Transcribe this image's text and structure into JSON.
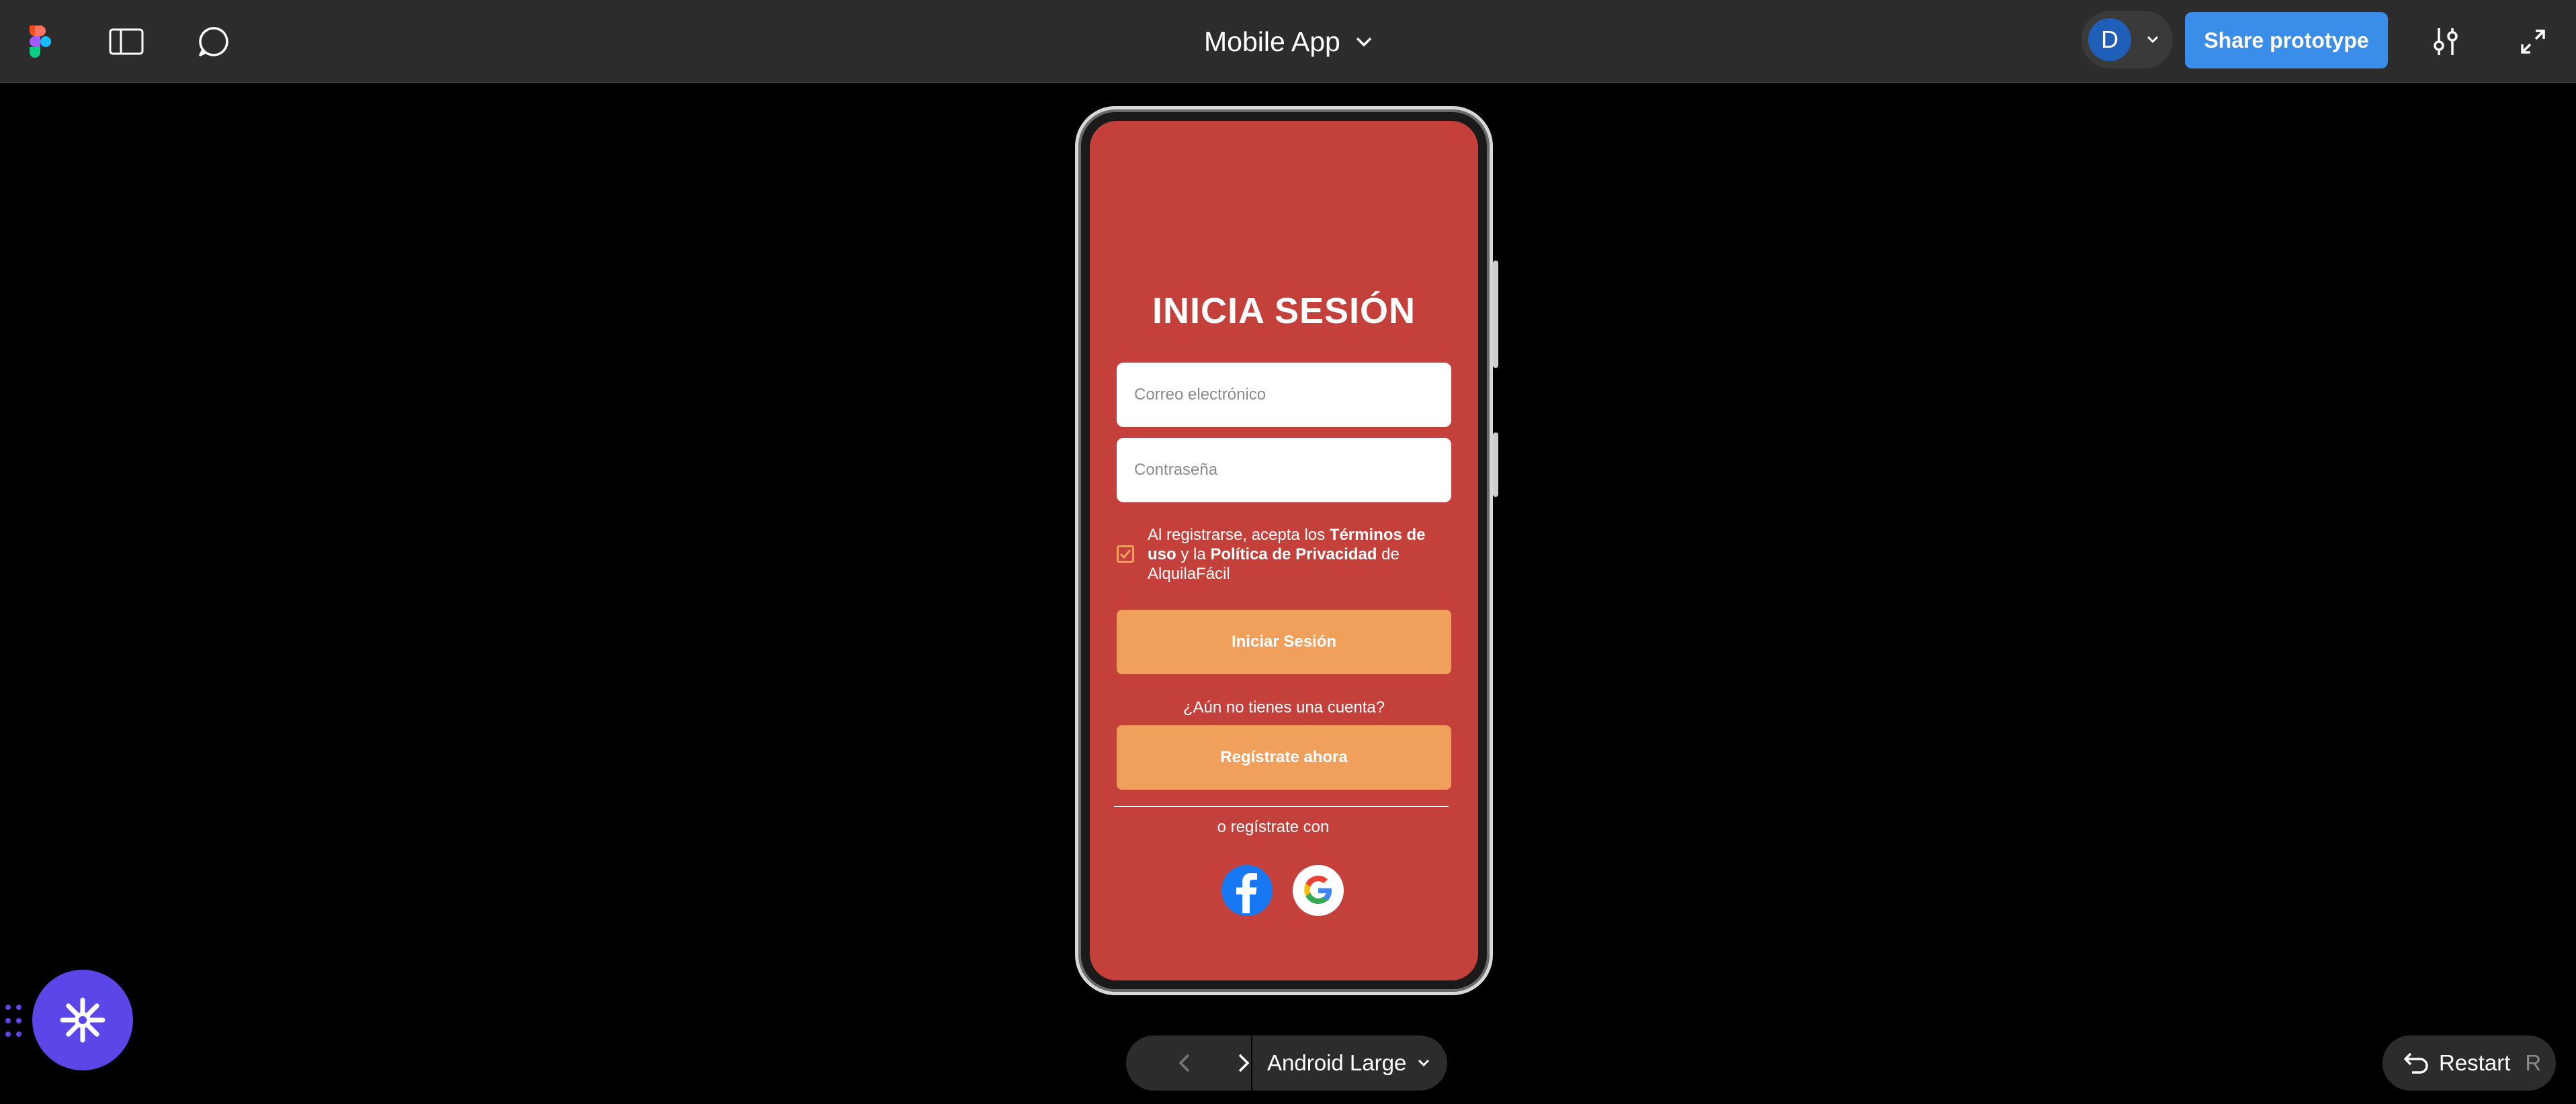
{
  "toolbar": {
    "doc_title": "Mobile App",
    "avatar_initial": "D",
    "share_label": "Share prototype"
  },
  "screen": {
    "title": "INICIA SESIÓN",
    "email_placeholder": "Correo electrónico",
    "password_placeholder": "Contraseña",
    "terms": {
      "part1": "Al registrarse, acepta los ",
      "link1": "Términos de uso",
      "part2": " y la ",
      "link2": "Política de Privacidad",
      "part3": " de AlquilaFácil",
      "checked": true
    },
    "login_button": "Iniciar Sesión",
    "no_account_text": "¿Aún no tienes una cuenta?",
    "register_button": "Regístrate ahora",
    "or_register_with": "o regístrate con",
    "social": [
      "facebook-icon",
      "google-icon"
    ]
  },
  "bottom": {
    "device_name": "Android Large",
    "restart_label": "Restart",
    "restart_shortcut": "R"
  },
  "colors": {
    "screen_bg": "#c3403b",
    "accent_orange": "#f0a05a",
    "share_blue": "#3a8ee8",
    "plugin_purple": "#5b46e8"
  }
}
